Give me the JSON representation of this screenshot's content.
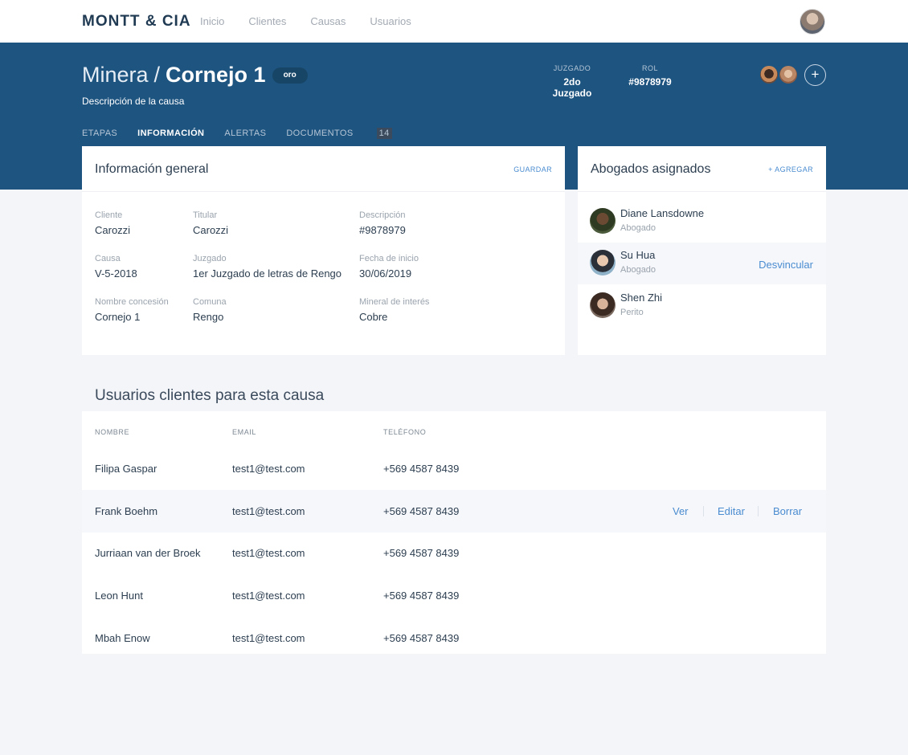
{
  "nav": {
    "brand": "MONTT & CIA",
    "links": [
      "Inicio",
      "Clientes",
      "Causas",
      "Usuarios"
    ]
  },
  "header": {
    "title_prefix": "Minera",
    "title_sep": "/",
    "title_main": "Cornejo 1",
    "badge": "oro",
    "subtitle": "Descripción de la causa",
    "juzgado_label": "JUZGADO",
    "juzgado_value": "2do Juzgado",
    "rol_label": "ROL",
    "rol_value": "#9878979",
    "add_icon": "+"
  },
  "tabs": [
    {
      "label": "ETAPAS"
    },
    {
      "label": "INFORMACIÓN"
    },
    {
      "label": "ALERTAS"
    },
    {
      "label": "DOCUMENTOS",
      "count": "14"
    }
  ],
  "info": {
    "title": "Información general",
    "action": "GUARDAR",
    "fields": [
      {
        "label": "Cliente",
        "value": "Carozzi"
      },
      {
        "label": "Titular",
        "value": "Carozzi"
      },
      {
        "label": "Descripción",
        "value": "#9878979"
      },
      {
        "label": "Causa",
        "value": "V-5-2018"
      },
      {
        "label": "Juzgado",
        "value": "1er Juzgado de letras de Rengo"
      },
      {
        "label": "Fecha de inicio",
        "value": "30/06/2019"
      },
      {
        "label": "Nombre concesión",
        "value": "Cornejo 1"
      },
      {
        "label": "Comuna",
        "value": "Rengo"
      },
      {
        "label": "Mineral de interés",
        "value": "Cobre"
      }
    ]
  },
  "lawyers": {
    "title": "Abogados asignados",
    "action": "+ AGREGAR",
    "unlink_label": "Desvincular",
    "items": [
      {
        "name": "Diane Lansdowne",
        "role": "Abogado"
      },
      {
        "name": "Su Hua",
        "role": "Abogado"
      },
      {
        "name": "Shen Zhi",
        "role": "Perito"
      }
    ]
  },
  "users": {
    "title": "Usuarios clientes para esta causa",
    "columns": [
      "NOMBRE",
      "EMAIL",
      "TELÉFONO"
    ],
    "actions": [
      "Ver",
      "Editar",
      "Borrar"
    ],
    "rows": [
      {
        "name": "Filipa Gaspar",
        "email": "test1@test.com",
        "phone": "+569 4587 8439"
      },
      {
        "name": "Frank Boehm",
        "email": "test1@test.com",
        "phone": "+569 4587 8439"
      },
      {
        "name": "Jurriaan van der Broek",
        "email": "test1@test.com",
        "phone": "+569 4587 8439"
      },
      {
        "name": "Leon Hunt",
        "email": "test1@test.com",
        "phone": "+569 4587 8439"
      },
      {
        "name": "Mbah Enow",
        "email": "test1@test.com",
        "phone": "+569 4587 8439"
      }
    ]
  },
  "colors": {
    "hero": "#1e5480",
    "accent": "#4a8cd0",
    "background": "#f4f5f9"
  }
}
